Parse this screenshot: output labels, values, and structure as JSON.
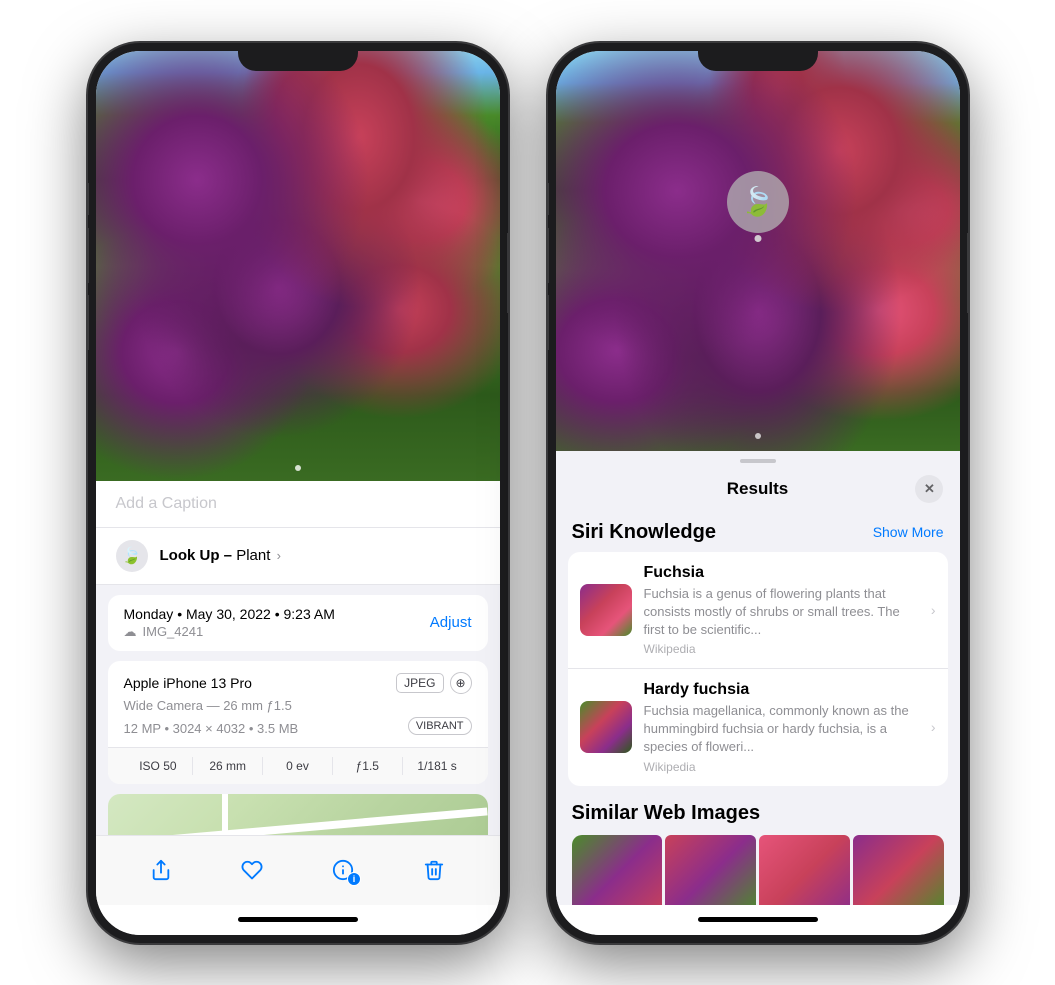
{
  "phone1": {
    "caption_placeholder": "Add a Caption",
    "lookup": {
      "label": "Look Up –",
      "subject": "Plant",
      "arrow": "›"
    },
    "metadata": {
      "date": "Monday • May 30, 2022 • 9:23 AM",
      "adjust_label": "Adjust",
      "filename": "IMG_4241",
      "camera_model": "Apple iPhone 13 Pro",
      "format_badge": "JPEG",
      "lens": "Wide Camera — 26 mm ƒ1.5",
      "specs": "12 MP  •  3024 × 4032  •  3.5 MB",
      "vibrant_badge": "VIBRANT",
      "iso": "ISO 50",
      "focal_length": "26 mm",
      "exposure": "0 ev",
      "aperture": "ƒ1.5",
      "shutter": "1/181 s"
    },
    "toolbar": {
      "share_icon": "↑",
      "favorite_icon": "♡",
      "info_icon": "ⓘ",
      "delete_icon": "🗑"
    }
  },
  "phone2": {
    "results_title": "Results",
    "close_label": "✕",
    "siri_knowledge": {
      "section_title": "Siri Knowledge",
      "show_more_label": "Show More",
      "items": [
        {
          "name": "Fuchsia",
          "description": "Fuchsia is a genus of flowering plants that consists mostly of shrubs or small trees. The first to be scientific...",
          "source": "Wikipedia"
        },
        {
          "name": "Hardy fuchsia",
          "description": "Fuchsia magellanica, commonly known as the hummingbird fuchsia or hardy fuchsia, is a species of floweri...",
          "source": "Wikipedia"
        }
      ]
    },
    "similar_web": {
      "section_title": "Similar Web Images"
    }
  }
}
